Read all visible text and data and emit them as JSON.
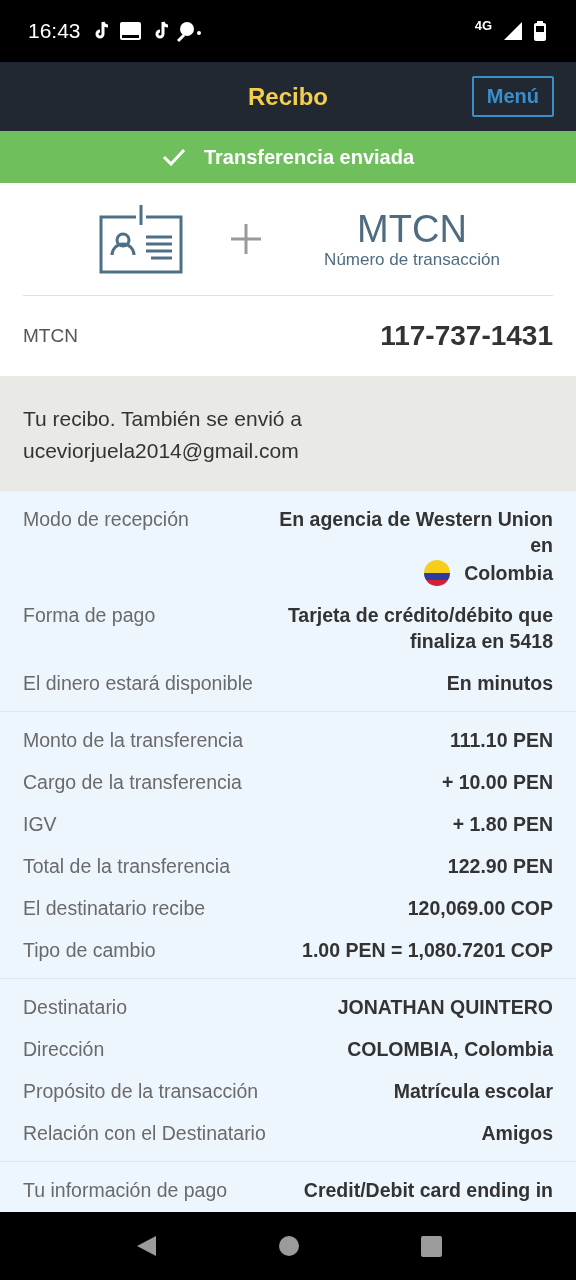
{
  "status_bar": {
    "time": "16:43",
    "network": "4G"
  },
  "header": {
    "title": "Recibo",
    "menu_button": "Menú"
  },
  "banner": {
    "text": "Transferencia enviada"
  },
  "mtcn_intro": {
    "title": "MTCN",
    "subtitle": "Número de transacción"
  },
  "mtcn_row": {
    "label": "MTCN",
    "value": "117-737-1431"
  },
  "notice": "Tu recibo. También se envió a uceviorjuela2014@gmail.com",
  "details": [
    [
      {
        "label": "Modo de recepción",
        "value": "En agencia de Western Union en",
        "country": "Colombia"
      },
      {
        "label": "Forma de pago",
        "value": "Tarjeta de crédito/débito que finaliza en 5418"
      },
      {
        "label": "El dinero estará disponible",
        "value": "En minutos"
      }
    ],
    [
      {
        "label": "Monto de la transferencia",
        "value": "111.10 PEN"
      },
      {
        "label": "Cargo de la transferencia",
        "value": "+ 10.00 PEN"
      },
      {
        "label": "IGV",
        "value": "+ 1.80 PEN"
      },
      {
        "label": "Total de la transferencia",
        "value": "122.90 PEN"
      },
      {
        "label": "El destinatario recibe",
        "value": "120,069.00 COP"
      },
      {
        "label": "Tipo de cambio",
        "value": "1.00 PEN = 1,080.7201 COP"
      }
    ],
    [
      {
        "label": "Destinatario",
        "value": "JONATHAN QUINTERO"
      },
      {
        "label": "Dirección",
        "value": "COLOMBIA, Colombia"
      },
      {
        "label": "Propósito de la transacción",
        "value": "Matrícula escolar"
      },
      {
        "label": "Relación con el Destinatario",
        "value": "Amigos"
      }
    ],
    [
      {
        "label": "Tu información de pago",
        "value": "Credit/Debit card ending in"
      }
    ]
  ]
}
